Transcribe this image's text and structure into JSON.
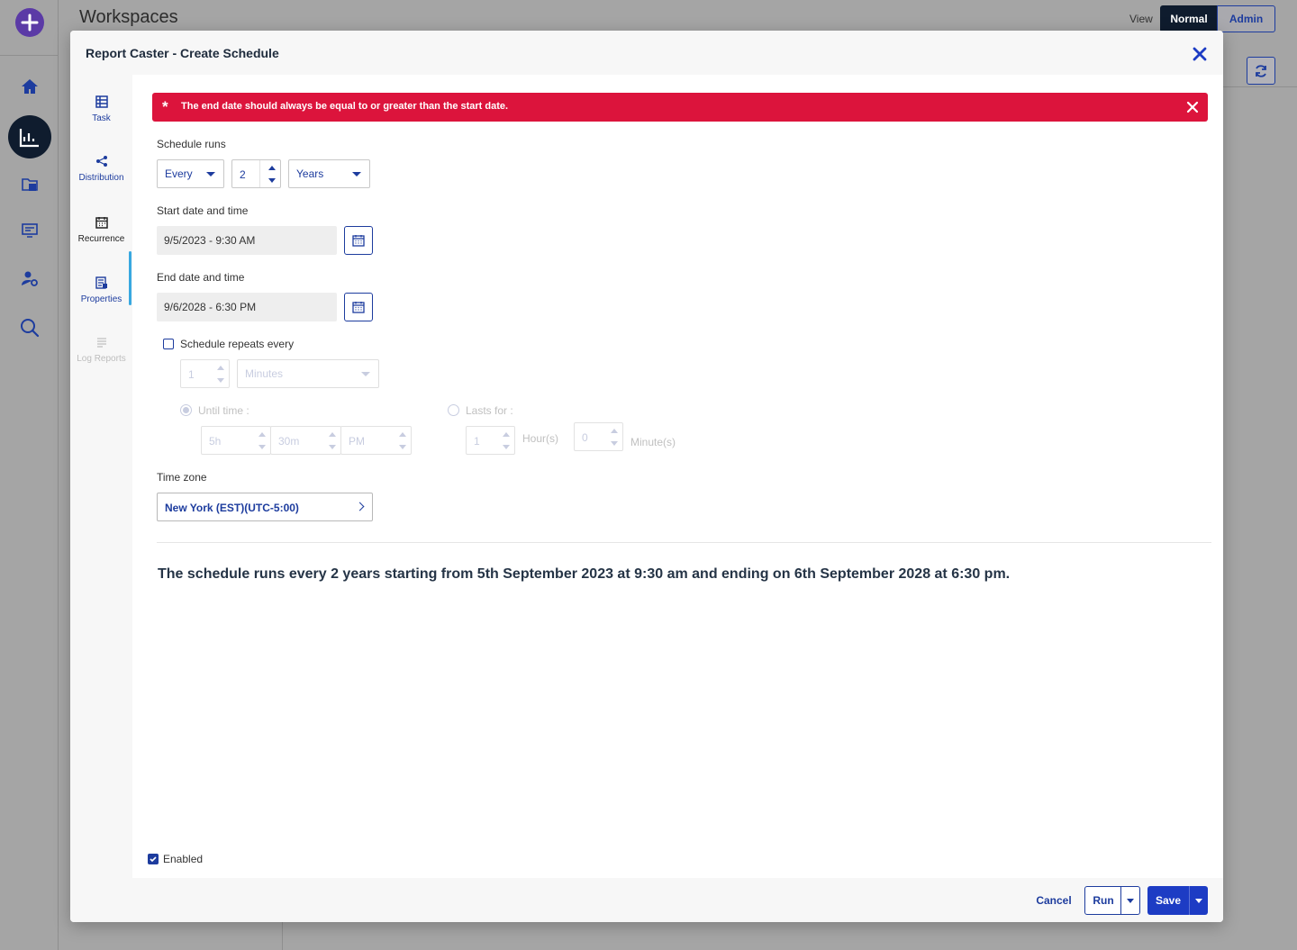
{
  "background": {
    "title": "Workspaces",
    "view_label": "View",
    "view_normal": "Normal",
    "view_admin": "Admin"
  },
  "modal": {
    "title": "Report Caster - Create Schedule"
  },
  "side_nav": {
    "items": [
      {
        "label": "Task",
        "icon": "table-icon",
        "state": "normal"
      },
      {
        "label": "Distribution",
        "icon": "share-icon",
        "state": "normal"
      },
      {
        "label": "Recurrence",
        "icon": "calendar-icon",
        "state": "active"
      },
      {
        "label": "Properties",
        "icon": "properties-icon",
        "state": "normal"
      },
      {
        "label": "Log Reports",
        "icon": "log-icon",
        "state": "disabled"
      }
    ]
  },
  "error": {
    "message": "The end date should always be equal to or greater than the start date.",
    "star": "*"
  },
  "schedule": {
    "runs_label": "Schedule runs",
    "frequency": "Every",
    "interval": "2",
    "unit": "Years",
    "start_label": "Start date and time",
    "start_value": "9/5/2023 - 9:30 AM",
    "end_label": "End date and time",
    "end_value": "9/6/2028 - 6:30 PM",
    "repeats_label": "Schedule repeats every",
    "repeats_checked": false,
    "repeat_interval": "1",
    "repeat_unit": "Minutes",
    "until_label": "Until time :",
    "until_hours": "5h",
    "until_minutes": "30m",
    "until_ampm": "PM",
    "lasts_label": "Lasts for :",
    "lasts_hours": "1",
    "hours_label": "Hour(s)",
    "lasts_minutes": "0",
    "minutes_label": "Minute(s)",
    "timezone_label": "Time zone",
    "timezone_value": "New York (EST)(UTC-5:00)",
    "summary": "The schedule runs every 2 years starting from 5th September 2023 at 9:30 am and ending on 6th September 2028 at 6:30 pm."
  },
  "footer": {
    "enabled_label": "Enabled",
    "enabled_checked": true,
    "cancel": "Cancel",
    "run": "Run",
    "save": "Save"
  },
  "colors": {
    "accent": "#1d3c9e",
    "error": "#dc143c",
    "active_indicator": "#38a8e0"
  }
}
